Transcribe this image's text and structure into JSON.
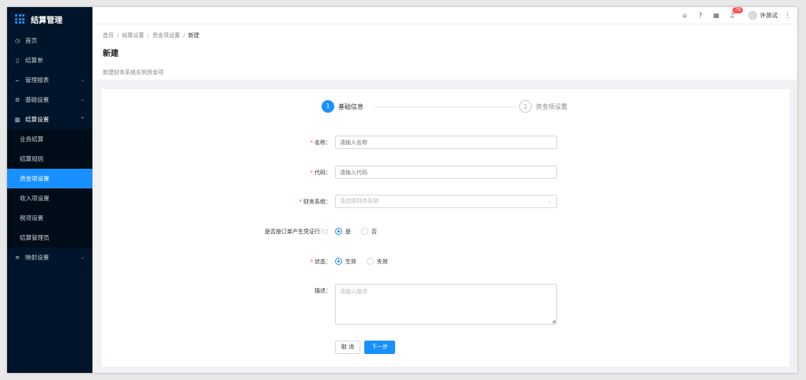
{
  "app": {
    "title": "结算管理"
  },
  "sidebar": {
    "items": [
      {
        "label": "首页",
        "icon": "dashboard-icon"
      },
      {
        "label": "结算单",
        "icon": "file-icon"
      },
      {
        "label": "管理报表",
        "icon": "line-chart-icon"
      },
      {
        "label": "基础设置",
        "icon": "settings-icon"
      },
      {
        "label": "结算设置",
        "icon": "bar-chart-icon"
      },
      {
        "label": "映射设置",
        "icon": "wifi-icon"
      }
    ],
    "submenu": [
      "业务结算",
      "结算规则",
      "资金项设置",
      "收入项设置",
      "税项设置",
      "结算管理员"
    ],
    "active": "资金项设置"
  },
  "header": {
    "notification_count": "79",
    "user_name": "许测试"
  },
  "breadcrumb": [
    "首页",
    "结算设置",
    "资金项设置",
    "新建"
  ],
  "page": {
    "title": "新建",
    "description": "新建财务系统实例资金项"
  },
  "steps": [
    {
      "number": "1",
      "label": "基础信息",
      "status": "active"
    },
    {
      "number": "2",
      "label": "资金项设置",
      "status": "pending"
    }
  ],
  "form": {
    "name": {
      "label": "名称",
      "required": true,
      "placeholder": "请输入名称"
    },
    "code": {
      "label": "代码",
      "required": true,
      "placeholder": "请输入代码"
    },
    "finance_system": {
      "label": "财务系统",
      "required": true,
      "placeholder": "请选择财务系统"
    },
    "voucher": {
      "label": "是否按订单产生凭证行",
      "required": false,
      "options": [
        "是",
        "否"
      ],
      "selected": "是"
    },
    "status": {
      "label": "状态",
      "required": true,
      "options": [
        "生效",
        "失效"
      ],
      "selected": "生效"
    },
    "description": {
      "label": "描述",
      "required": false,
      "placeholder": "请输入描述"
    }
  },
  "buttons": {
    "cancel": "取 消",
    "next": "下一步"
  },
  "colors": {
    "primary": "#1890ff",
    "sidebar": "#001529",
    "required": "#ff4d4f"
  }
}
